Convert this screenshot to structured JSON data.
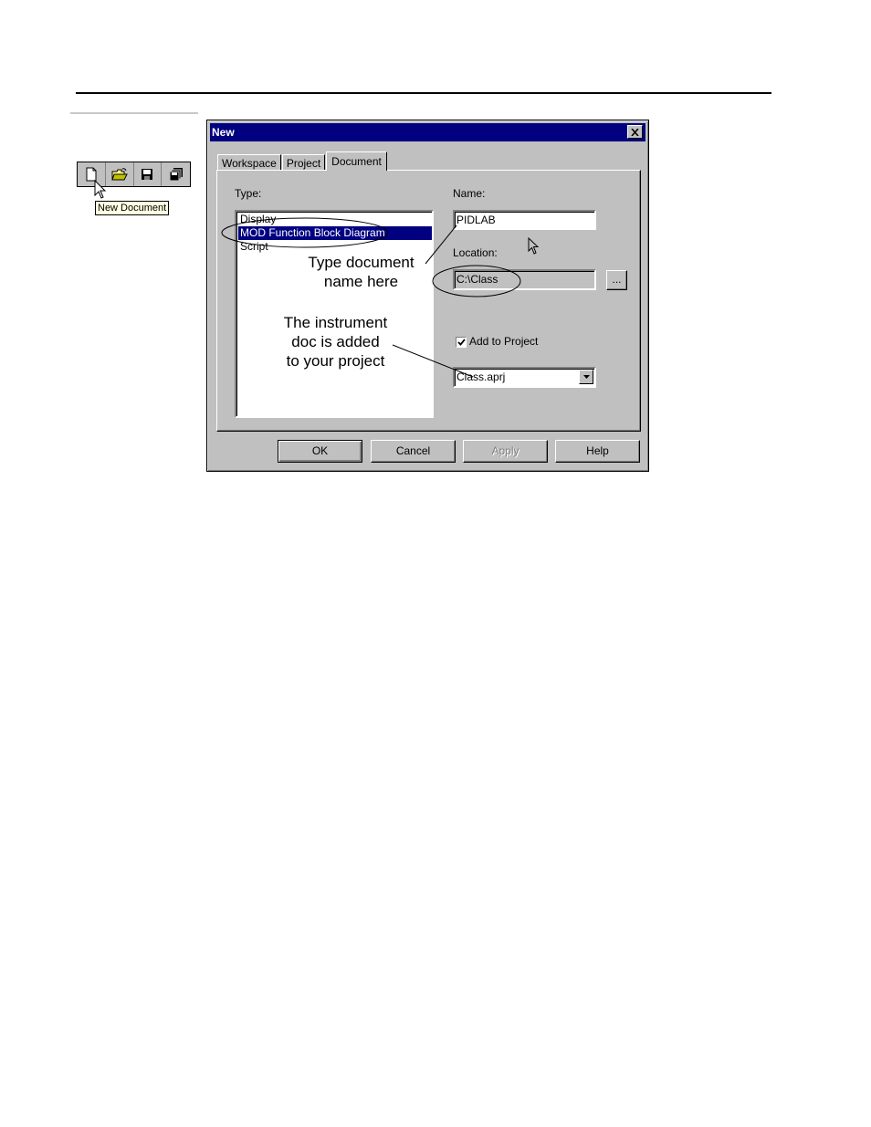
{
  "toolbar": {
    "tooltip": "New Document",
    "buttons": [
      "new-document-icon",
      "open-folder-icon",
      "save-icon",
      "save-all-icon"
    ]
  },
  "dialog": {
    "title": "New",
    "tabs": [
      "Workspace",
      "Project",
      "Document"
    ],
    "active_tab": "Document",
    "type_label": "Type:",
    "type_items": [
      "Display",
      "MOD Function Block Diagram",
      "Script"
    ],
    "selected_type": "MOD Function Block Diagram",
    "name_label": "Name:",
    "name_value": "PIDLAB",
    "location_label": "Location:",
    "location_value": "C:\\Class",
    "browse_label": "...",
    "add_to_project_label": "Add to Project",
    "add_to_project_checked": true,
    "project_value": "Class.aprj",
    "buttons": {
      "ok": "OK",
      "cancel": "Cancel",
      "apply": "Apply",
      "help": "Help"
    }
  },
  "annotations": {
    "name_hint_line1": "Type document",
    "name_hint_line2": "name here",
    "project_hint_line1": "The instrument",
    "project_hint_line2": "doc is added",
    "project_hint_line3": "to your project"
  }
}
